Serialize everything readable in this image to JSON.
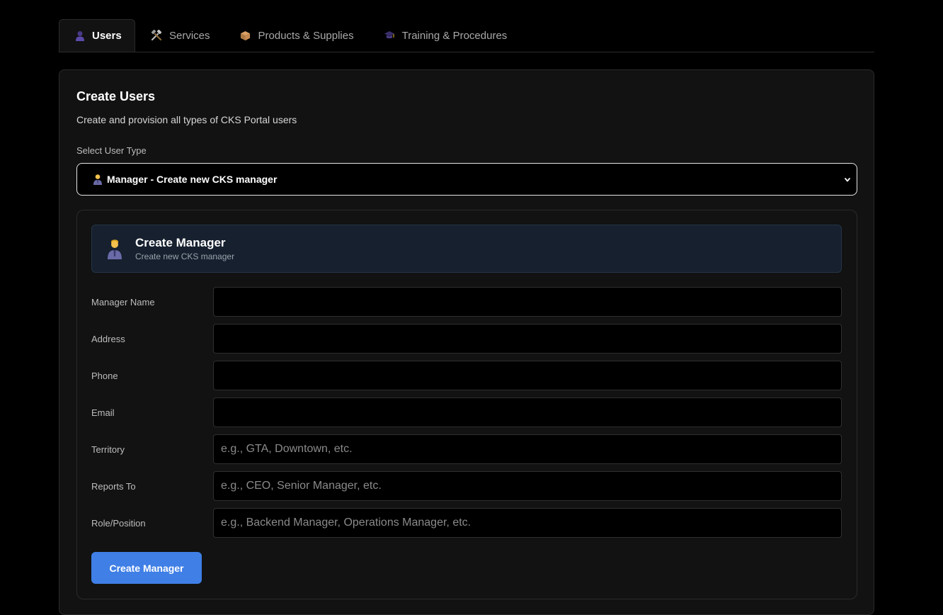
{
  "tabs": [
    {
      "label": "Users",
      "icon": "user-icon",
      "active": true
    },
    {
      "label": "Services",
      "icon": "tools-icon",
      "active": false
    },
    {
      "label": "Products & Supplies",
      "icon": "package-icon",
      "active": false
    },
    {
      "label": "Training & Procedures",
      "icon": "graduation-cap-icon",
      "active": false
    }
  ],
  "card": {
    "title": "Create Users",
    "subtitle": "Create and provision all types of CKS Portal users"
  },
  "user_type": {
    "label": "Select User Type",
    "selected": "Manager - Create new CKS manager",
    "icon": "manager-icon"
  },
  "form": {
    "banner_title": "Create Manager",
    "banner_subtitle": "Create new CKS manager",
    "banner_icon": "manager-icon",
    "fields": [
      {
        "label": "Manager Name",
        "value": "",
        "placeholder": ""
      },
      {
        "label": "Address",
        "value": "",
        "placeholder": ""
      },
      {
        "label": "Phone",
        "value": "",
        "placeholder": ""
      },
      {
        "label": "Email",
        "value": "",
        "placeholder": ""
      },
      {
        "label": "Territory",
        "value": "",
        "placeholder": "e.g., GTA, Downtown, etc."
      },
      {
        "label": "Reports To",
        "value": "",
        "placeholder": "e.g., CEO, Senior Manager, etc."
      },
      {
        "label": "Role/Position",
        "value": "",
        "placeholder": "e.g., Backend Manager, Operations Manager, etc."
      }
    ],
    "submit_label": "Create Manager"
  },
  "colors": {
    "background": "#000000",
    "card": "#121212",
    "banner": "#16202e",
    "accent": "#3f7fe6"
  }
}
